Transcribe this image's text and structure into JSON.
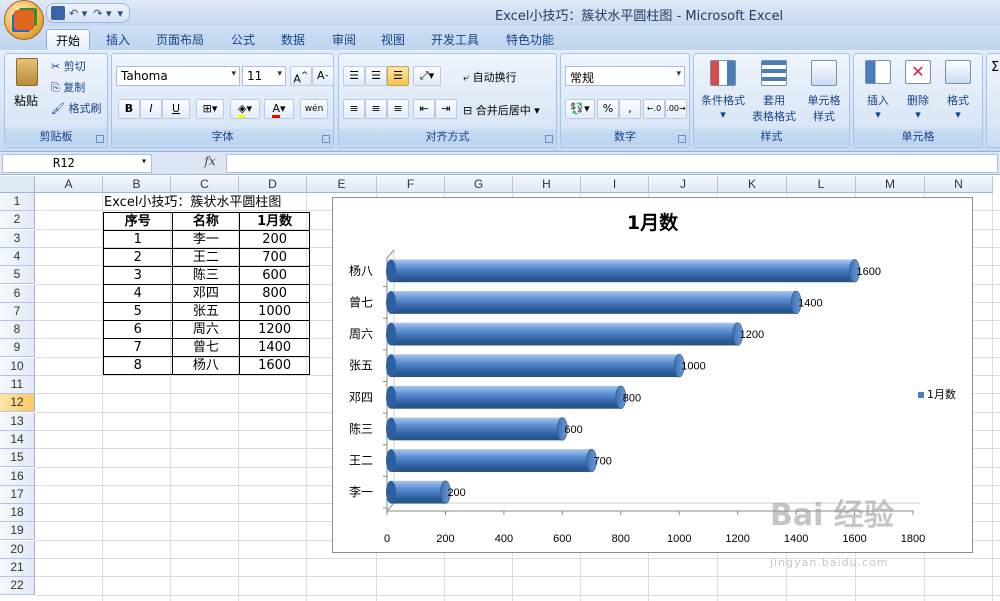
{
  "window": {
    "title": "Excel小技巧：簇状水平圆柱图 - Microsoft Excel"
  },
  "ribbon_tabs": [
    "开始",
    "插入",
    "页面布局",
    "公式",
    "数据",
    "审阅",
    "视图",
    "开发工具",
    "特色功能"
  ],
  "ribbon": {
    "clipboard": {
      "paste": "粘贴",
      "cut": "剪切",
      "copy": "复制",
      "format_painter": "格式刷",
      "label": "剪贴板"
    },
    "font": {
      "name": "Tahoma",
      "size": "11",
      "label": "字体",
      "bold": "B",
      "italic": "I",
      "underline": "U",
      "wen": "wén"
    },
    "alignment": {
      "wrap": "自动换行",
      "merge": "合并后居中",
      "label": "对齐方式"
    },
    "number": {
      "format": "常规",
      "percent": "%",
      "comma": ",",
      "label": "数字"
    },
    "styles": {
      "conditional": "条件格式",
      "table_format_1": "套用",
      "table_format_2": "表格格式",
      "cell_style_1": "单元格",
      "cell_style_2": "样式",
      "label": "样式"
    },
    "cells": {
      "insert": "插入",
      "delete": "删除",
      "format": "格式",
      "label": "单元格"
    },
    "editing": {
      "sigma": "Σ"
    }
  },
  "formula_bar": {
    "name_box": "R12",
    "fx": "fx",
    "content": ""
  },
  "columns": [
    "A",
    "B",
    "C",
    "D",
    "E",
    "F",
    "G",
    "H",
    "I",
    "J",
    "K",
    "L",
    "M",
    "N"
  ],
  "rows": [
    "1",
    "2",
    "3",
    "4",
    "5",
    "6",
    "7",
    "8",
    "9",
    "10",
    "11",
    "12",
    "13",
    "14",
    "15",
    "16",
    "17",
    "18",
    "19",
    "20",
    "21",
    "22"
  ],
  "selected_row": "12",
  "sheet": {
    "title_cell": "Excel小技巧：簇状水平圆柱图",
    "headers": [
      "序号",
      "名称",
      "1月数"
    ],
    "rows": [
      [
        "1",
        "李一",
        "200"
      ],
      [
        "2",
        "王二",
        "700"
      ],
      [
        "3",
        "陈三",
        "600"
      ],
      [
        "4",
        "邓四",
        "800"
      ],
      [
        "5",
        "张五",
        "1000"
      ],
      [
        "6",
        "周六",
        "1200"
      ],
      [
        "7",
        "曾七",
        "1400"
      ],
      [
        "8",
        "杨八",
        "1600"
      ]
    ]
  },
  "chart_data": {
    "type": "bar",
    "title": "1月数",
    "categories": [
      "李一",
      "王二",
      "陈三",
      "邓四",
      "张五",
      "周六",
      "曾七",
      "杨八"
    ],
    "series": [
      {
        "name": "1月数",
        "values": [
          200,
          700,
          600,
          800,
          1000,
          1200,
          1400,
          1600
        ]
      }
    ],
    "xticks": [
      "0",
      "200",
      "400",
      "600",
      "800",
      "1000",
      "1200",
      "1400",
      "1600",
      "1800"
    ],
    "xlim": [
      0,
      1800
    ],
    "legend": "right",
    "bar_color": "#4a7ebb",
    "grid": false
  },
  "watermark": {
    "brand": "Bai 经验",
    "url": "jingyan.baidu.com"
  }
}
